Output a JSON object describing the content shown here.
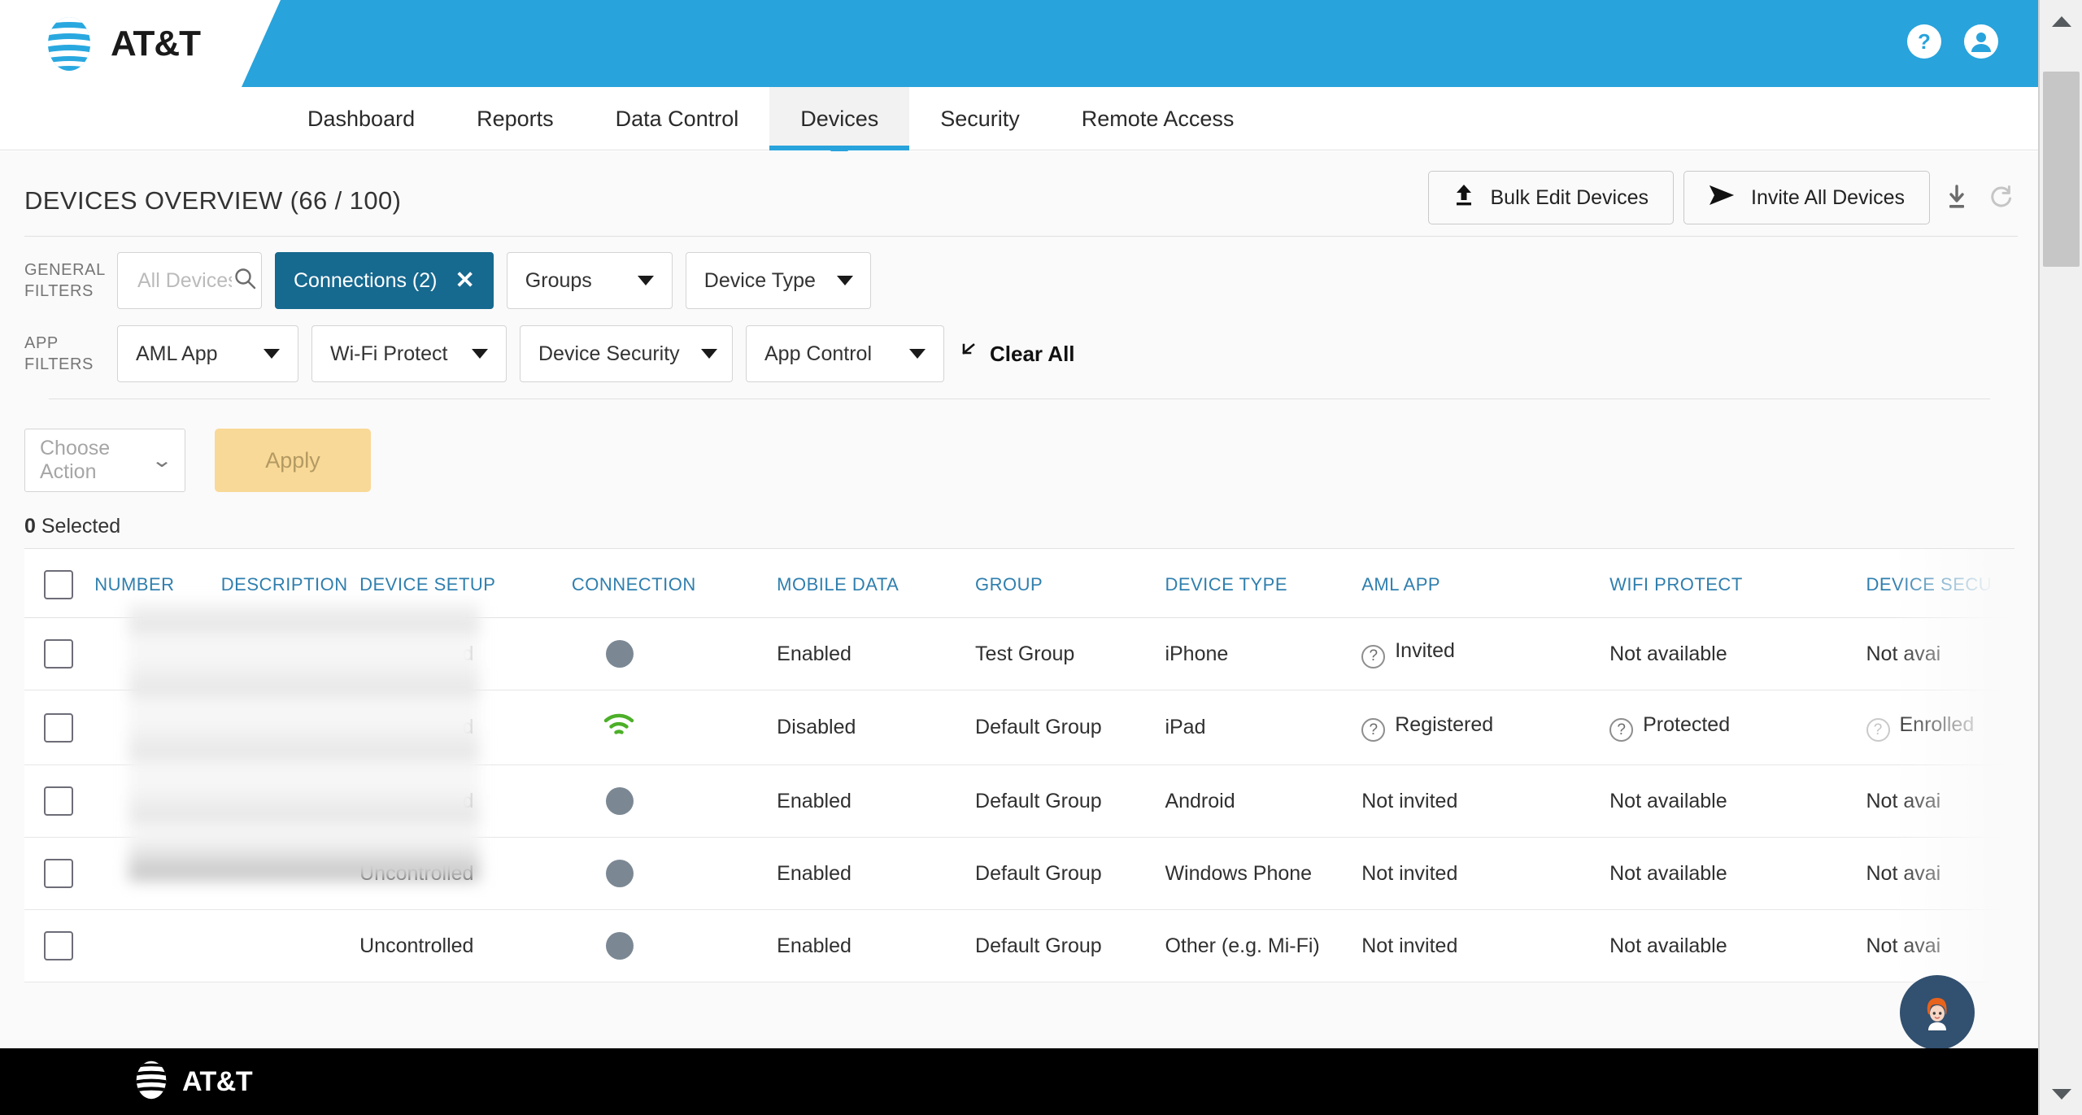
{
  "brand": {
    "name": "AT&T",
    "accent_blue": "#28a3dc",
    "chip_blue": "#16698f",
    "header_link_blue": "#2f7fae",
    "apply_yellow": "#f9d997"
  },
  "topbar": {
    "help_icon": "help-circle-icon",
    "account_icon": "account-circle-icon"
  },
  "nav": {
    "tabs": [
      {
        "label": "Dashboard",
        "active": false
      },
      {
        "label": "Reports",
        "active": false
      },
      {
        "label": "Data Control",
        "active": false
      },
      {
        "label": "Devices",
        "active": true
      },
      {
        "label": "Security",
        "active": false
      },
      {
        "label": "Remote Access",
        "active": false
      }
    ]
  },
  "header": {
    "title": "DEVICES OVERVIEW (66 / 100)",
    "device_count": 66,
    "device_limit": 100,
    "bulk_edit_label": "Bulk Edit Devices",
    "invite_all_label": "Invite All Devices",
    "download_icon": "download-icon",
    "refresh_icon": "refresh-icon"
  },
  "general_filters": {
    "label": "GENERAL FILTERS",
    "search_placeholder": "All Devices",
    "search_value": "",
    "search_icon": "search-icon",
    "connections_chip": "Connections (2)",
    "connections_count": 2,
    "groups_label": "Groups",
    "device_type_label": "Device Type"
  },
  "app_filters": {
    "label": "APP FILTERS",
    "aml_app_label": "AML App",
    "wifi_protect_label": "Wi-Fi Protect",
    "device_security_label": "Device Security",
    "app_control_label": "App Control",
    "clear_all_label": "Clear All"
  },
  "action_bar": {
    "choose_action_placeholder": "Choose Action",
    "apply_label": "Apply",
    "selected_count": "0",
    "selected_label": "Selected"
  },
  "table": {
    "columns": [
      "NUMBER",
      "DESCRIPTION",
      "DEVICE SETUP",
      "CONNECTION",
      "MOBILE DATA",
      "GROUP",
      "DEVICE TYPE",
      "AML APP",
      "WIFI PROTECT",
      "DEVICE SECU"
    ],
    "rows": [
      {
        "number": "",
        "description": "",
        "device_setup": "Uncontrolled",
        "connection": "none",
        "mobile_data": "Enabled",
        "group": "Test Group",
        "device_type": "iPhone",
        "aml_app": "Invited",
        "aml_app_has_info": true,
        "wifi_protect": "Not available",
        "wifi_protect_has_info": false,
        "device_security": "Not avai",
        "device_security_has_info": false
      },
      {
        "number": "",
        "description": "",
        "device_setup": "Uncontrolled",
        "connection": "wifi",
        "mobile_data": "Disabled",
        "group": "Default Group",
        "device_type": "iPad",
        "aml_app": "Registered",
        "aml_app_has_info": true,
        "wifi_protect": "Protected",
        "wifi_protect_has_info": true,
        "device_security": "Enrolled",
        "device_security_has_info": true
      },
      {
        "number": "",
        "description": "",
        "device_setup": "Uncontrolled",
        "connection": "none",
        "mobile_data": "Enabled",
        "group": "Default Group",
        "device_type": "Android",
        "aml_app": "Not invited",
        "aml_app_has_info": false,
        "wifi_protect": "Not available",
        "wifi_protect_has_info": false,
        "device_security": "Not avai",
        "device_security_has_info": false
      },
      {
        "number": "",
        "description": "",
        "device_setup": "Uncontrolled",
        "connection": "none",
        "mobile_data": "Enabled",
        "group": "Default Group",
        "device_type": "Windows Phone",
        "aml_app": "Not invited",
        "aml_app_has_info": false,
        "wifi_protect": "Not available",
        "wifi_protect_has_info": false,
        "device_security": "Not avai",
        "device_security_has_info": false
      },
      {
        "number": "",
        "description": "",
        "device_setup": "Uncontrolled",
        "connection": "none",
        "mobile_data": "Enabled",
        "group": "Default Group",
        "device_type": "Other (e.g. Mi-Fi)",
        "aml_app": "Not invited",
        "aml_app_has_info": false,
        "wifi_protect": "Not available",
        "wifi_protect_has_info": false,
        "device_security": "Not avai",
        "device_security_has_info": false
      }
    ]
  },
  "chat_widget": {
    "icon": "chat-avatar-icon"
  },
  "footer": {
    "brand": "AT&T"
  },
  "scrollbar": {
    "up_icon": "chevron-up-icon",
    "down_icon": "chevron-down-icon"
  }
}
